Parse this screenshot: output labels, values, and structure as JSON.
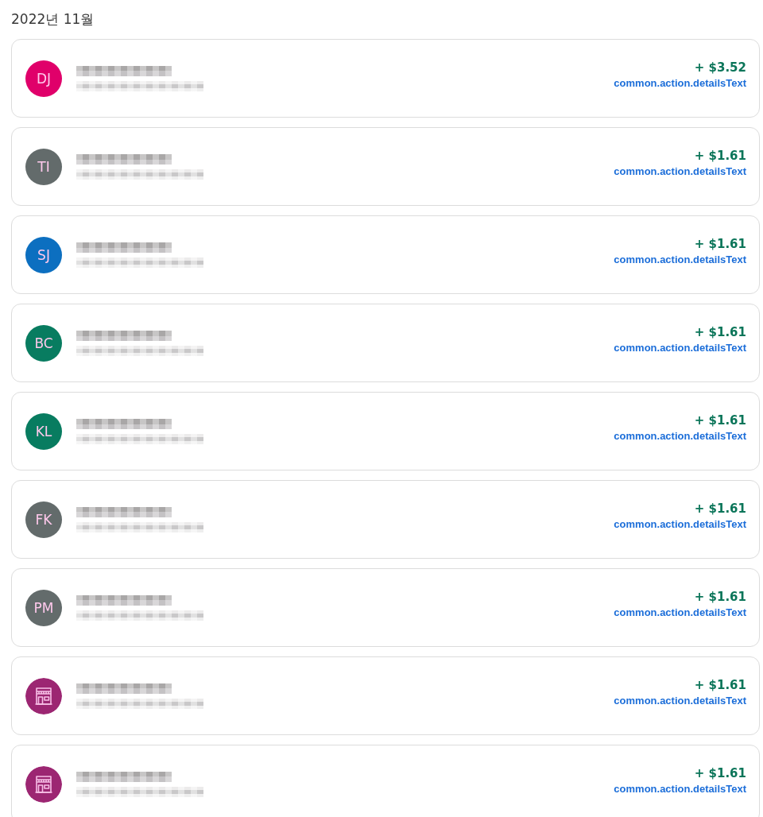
{
  "month_heading": "2022년 11월",
  "transactions": [
    {
      "avatar": {
        "kind": "initials",
        "initials": "DJ",
        "color": "#e0006a"
      },
      "amount": "+ $3.52",
      "link": "common.action.detailsText"
    },
    {
      "avatar": {
        "kind": "initials",
        "initials": "TI",
        "color": "#636b6b"
      },
      "amount": "+ $1.61",
      "link": "common.action.detailsText"
    },
    {
      "avatar": {
        "kind": "initials",
        "initials": "SJ",
        "color": "#0c6fc0"
      },
      "amount": "+ $1.61",
      "link": "common.action.detailsText"
    },
    {
      "avatar": {
        "kind": "initials",
        "initials": "BC",
        "color": "#087c60"
      },
      "amount": "+ $1.61",
      "link": "common.action.detailsText"
    },
    {
      "avatar": {
        "kind": "initials",
        "initials": "KL",
        "color": "#087c60"
      },
      "amount": "+ $1.61",
      "link": "common.action.detailsText"
    },
    {
      "avatar": {
        "kind": "initials",
        "initials": "FK",
        "color": "#636b6b"
      },
      "amount": "+ $1.61",
      "link": "common.action.detailsText"
    },
    {
      "avatar": {
        "kind": "initials",
        "initials": "PM",
        "color": "#636b6b"
      },
      "amount": "+ $1.61",
      "link": "common.action.detailsText"
    },
    {
      "avatar": {
        "kind": "store",
        "color": "#9c2672"
      },
      "amount": "+ $1.61",
      "link": "common.action.detailsText"
    },
    {
      "avatar": {
        "kind": "store",
        "color": "#9c2672"
      },
      "amount": "+ $1.61",
      "link": "common.action.detailsText"
    }
  ]
}
